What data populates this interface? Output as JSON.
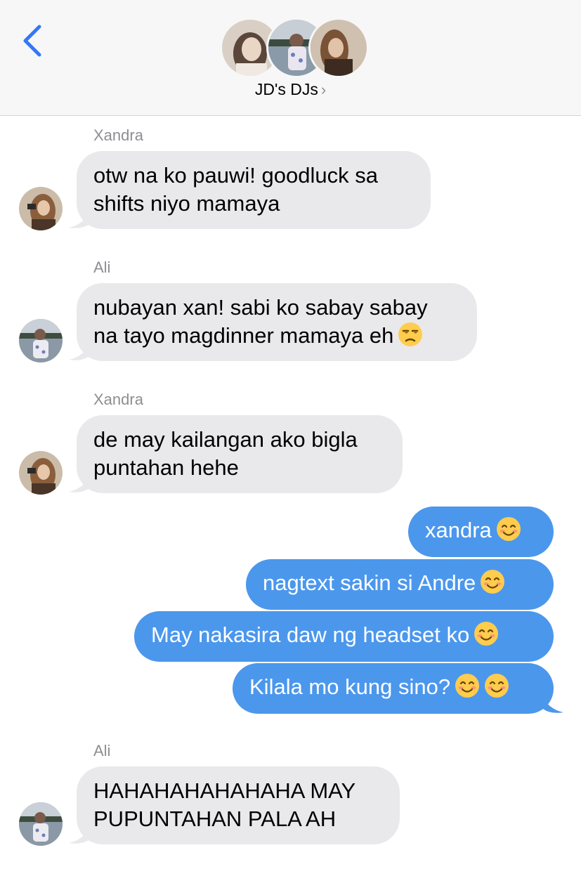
{
  "header": {
    "back_icon": "chevron-left-icon",
    "group_name": "JD's DJs",
    "chevron": "›"
  },
  "messages": [
    {
      "sender": "Xandra",
      "direction": "incoming",
      "lines": [
        "otw na ko pauwi! goodluck sa",
        "shifts niyo mamaya"
      ]
    },
    {
      "sender": "Ali",
      "direction": "incoming",
      "lines": [
        "nubayan xan! sabi ko sabay sabay",
        "na tayo magdinner mamaya eh"
      ],
      "emoji": [
        "unamused-face"
      ]
    },
    {
      "sender": "Xandra",
      "direction": "incoming",
      "lines": [
        "de may kailangan ako bigla",
        "puntahan hehe"
      ]
    },
    {
      "direction": "outgoing",
      "text": "xandra",
      "emoji": [
        "smiling-face"
      ]
    },
    {
      "direction": "outgoing",
      "text": "nagtext sakin si Andre",
      "emoji": [
        "smiling-face"
      ]
    },
    {
      "direction": "outgoing",
      "text": "May nakasira daw ng headset ko",
      "emoji": [
        "smiling-face"
      ]
    },
    {
      "direction": "outgoing",
      "text": "Kilala mo kung sino?",
      "emoji": [
        "smiling-face",
        "smiling-face"
      ]
    },
    {
      "sender": "Ali",
      "direction": "incoming",
      "lines": [
        "HAHAHAHAHAHAHA MAY",
        "PUPUNTAHAN PALA AH"
      ]
    }
  ],
  "colors": {
    "incoming_bubble": "#e9e9eb",
    "outgoing_bubble": "#4b97ec",
    "accent": "#3478f6",
    "sender_label": "#8e8e93"
  }
}
